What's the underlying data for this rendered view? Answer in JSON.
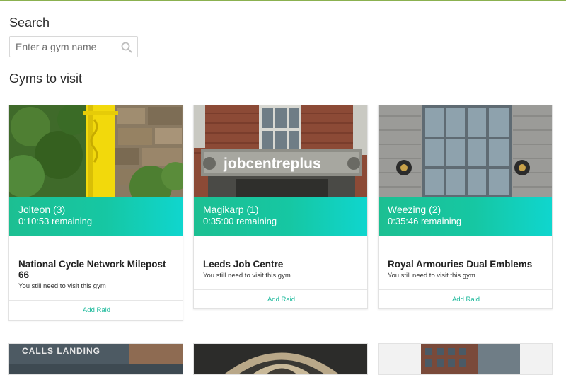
{
  "search": {
    "title": "Search",
    "placeholder": "Enter a gym name"
  },
  "section": {
    "title": "Gyms to visit"
  },
  "colors": {
    "accent": "#1cbf92",
    "accent_end": "#0fd6cf",
    "topline": "#8bb150",
    "link": "#18b89a"
  },
  "gyms": [
    {
      "pokemon": "Jolteon (3)",
      "remaining": "0:10:53 remaining",
      "name": "National Cycle Network Milepost 66",
      "status": "You still need to visit this gym",
      "action": "Add Raid"
    },
    {
      "pokemon": "Magikarp (1)",
      "remaining": "0:35:00 remaining",
      "name": "Leeds Job Centre",
      "status": "You still need to visit this gym",
      "action": "Add Raid",
      "sign_text": "jobcentreplus"
    },
    {
      "pokemon": "Weezing (2)",
      "remaining": "0:35:46 remaining",
      "name": "Royal Armouries Dual Emblems",
      "status": "You still need to visit this gym",
      "action": "Add Raid"
    }
  ],
  "partial_cards": [
    {
      "sign_text": "CALLS LANDING"
    }
  ]
}
